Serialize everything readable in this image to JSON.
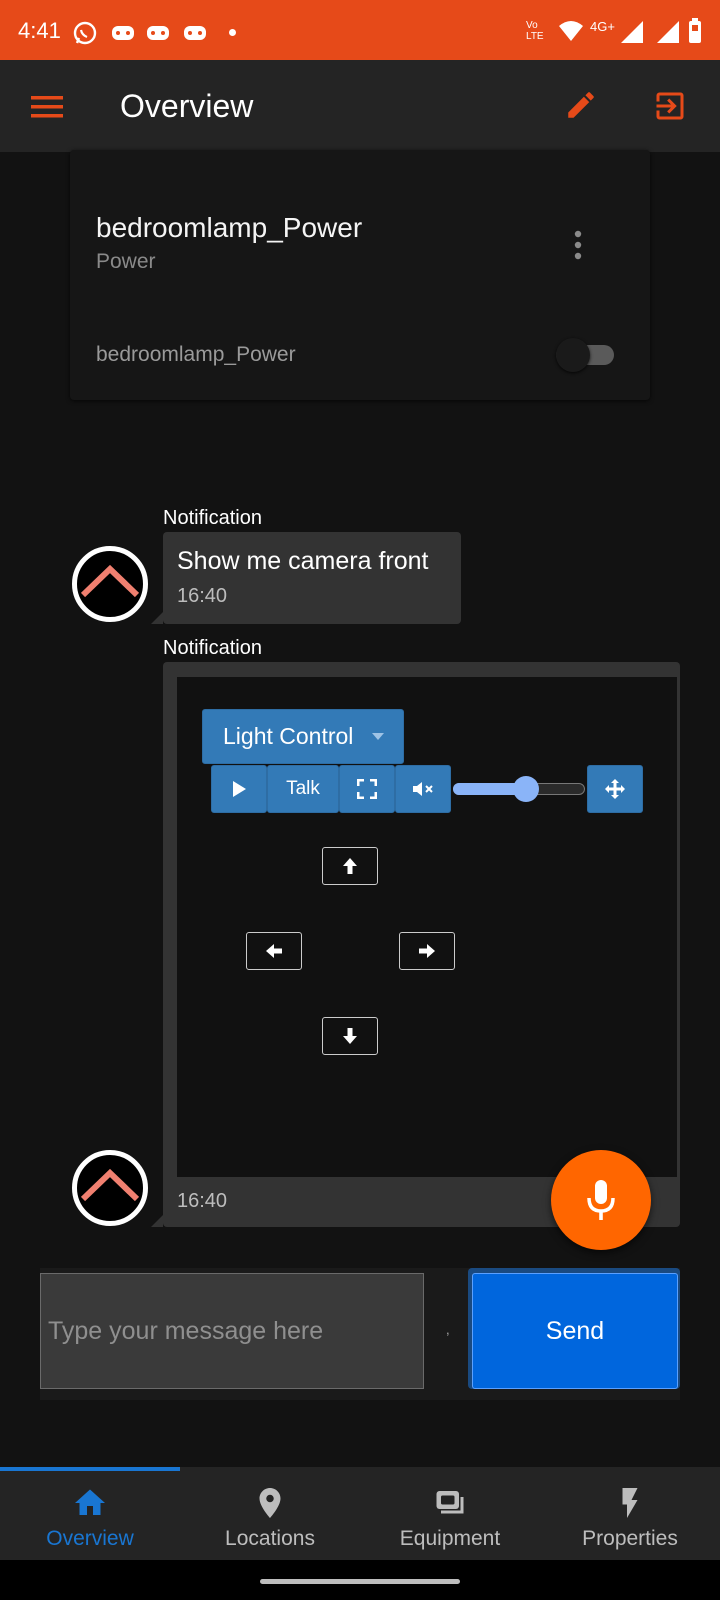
{
  "status_bar": {
    "time": "4:41",
    "network": "4G+",
    "volte": "Vo LTE"
  },
  "app_bar": {
    "title": "Overview",
    "menu_icon": "menu-icon",
    "edit_icon": "pencil-icon",
    "logout_icon": "logout-icon"
  },
  "card": {
    "title": "bedroomlamp_Power",
    "subtitle": "Power",
    "item_label": "bedroomlamp_Power",
    "toggle_state": "off"
  },
  "messages": [
    {
      "sender_label": "Notification",
      "text": "Show me camera front",
      "time": "16:40"
    },
    {
      "sender_label": "Notification",
      "time": "16:40"
    }
  ],
  "camera_widget": {
    "dropdown_label": "Light Control",
    "talk_label": "Talk",
    "volume_level": 0.55
  },
  "composer": {
    "placeholder": "Type your message here",
    "separator": ",",
    "send_label": "Send"
  },
  "bottom_nav": [
    {
      "label": "Overview",
      "active": true
    },
    {
      "label": "Locations",
      "active": false
    },
    {
      "label": "Equipment",
      "active": false
    },
    {
      "label": "Properties",
      "active": false
    }
  ],
  "colors": {
    "status_bar": "#E64A19",
    "accent_orange": "#FF6600",
    "nav_active": "#1976D2",
    "send_button": "#0066dd",
    "control_blue": "#337ab7"
  }
}
